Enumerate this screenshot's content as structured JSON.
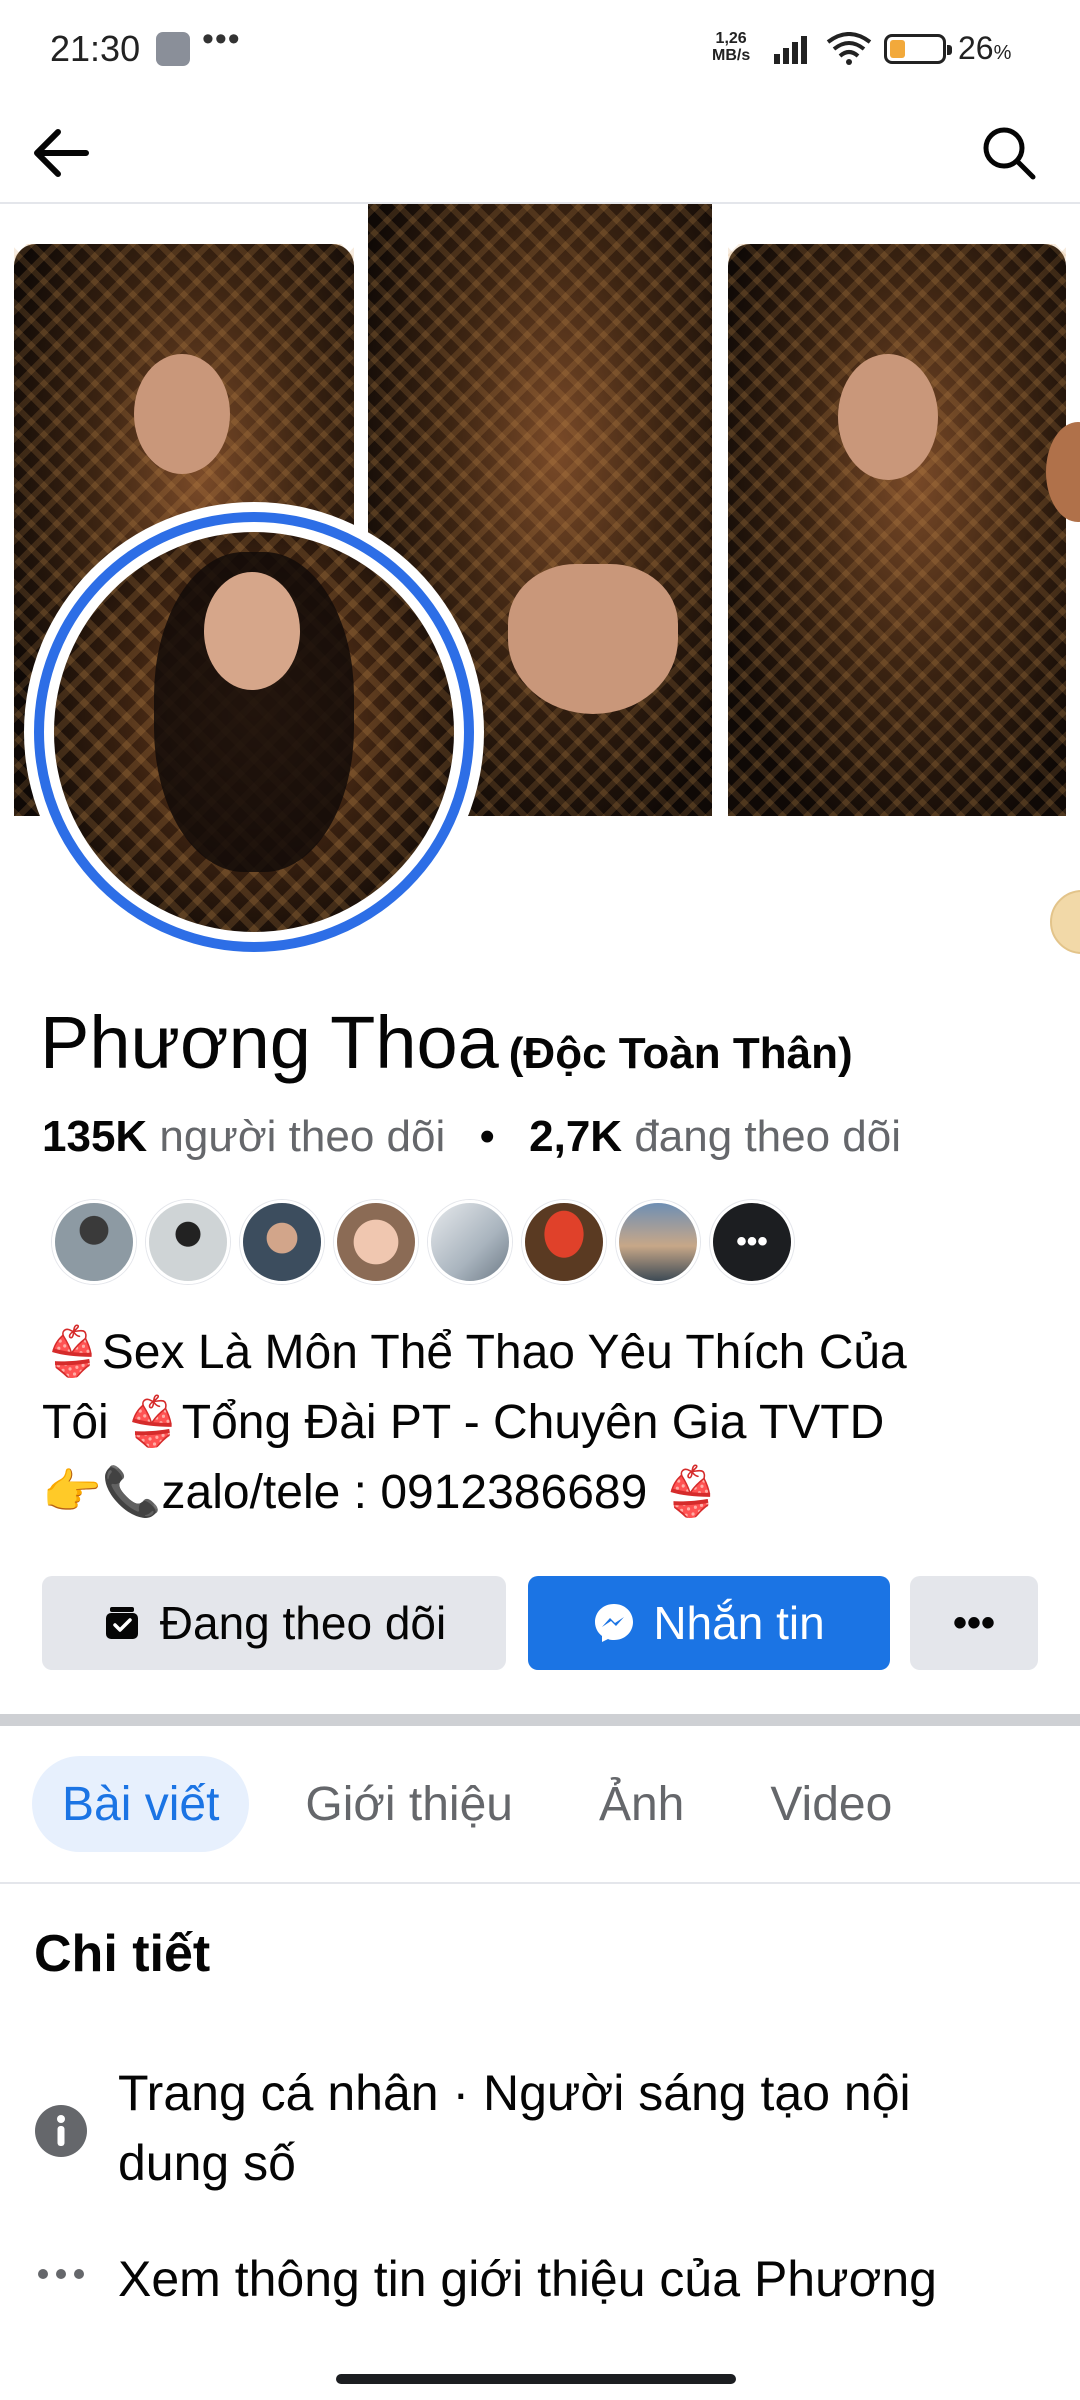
{
  "status_bar": {
    "time": "21:30",
    "dots": "•••",
    "net_speed_value": "1,26",
    "net_speed_unit": "MB/s",
    "battery_percent": "26",
    "battery_percent_unit": "%",
    "battery_level": 0.26
  },
  "profile": {
    "name": "Phương Thoa",
    "name_suffix": "(Độc Toàn Thân)",
    "followers_count": "135K",
    "followers_label": "người theo dõi",
    "separator": "•",
    "following_count": "2,7K",
    "following_label": "đang theo dõi",
    "follower_more": "•••",
    "bio_line1": "👙Sex Là Môn Thể Thao Yêu Thích Của",
    "bio_line2": "Tôi 👙Tổng Đài PT - Chuyên Gia TVTD",
    "bio_line3": "👉📞zalo/tele : 0912386689 👙"
  },
  "actions": {
    "following_label": "Đang theo dõi",
    "message_label": "Nhắn tin",
    "more_label": "•••"
  },
  "tabs": [
    {
      "label": "Bài viết"
    },
    {
      "label": "Giới thiệu"
    },
    {
      "label": "Ảnh"
    },
    {
      "label": "Video"
    }
  ],
  "details": {
    "title": "Chi tiết",
    "row1_text": "Trang cá nhân · Người sáng tạo nội dung số",
    "row2_text": "Xem thông tin giới thiệu của Phương"
  },
  "colors": {
    "accent": "#1b74e4",
    "avatar_ring": "#2d6ee6",
    "button_gray": "#e4e6eb",
    "battery": "#f2a93b"
  },
  "icons": {
    "back": "arrow-left-icon",
    "search": "search-icon",
    "following": "following-box-icon",
    "message": "messenger-icon",
    "info": "info-icon",
    "more": "more-dots-icon"
  }
}
